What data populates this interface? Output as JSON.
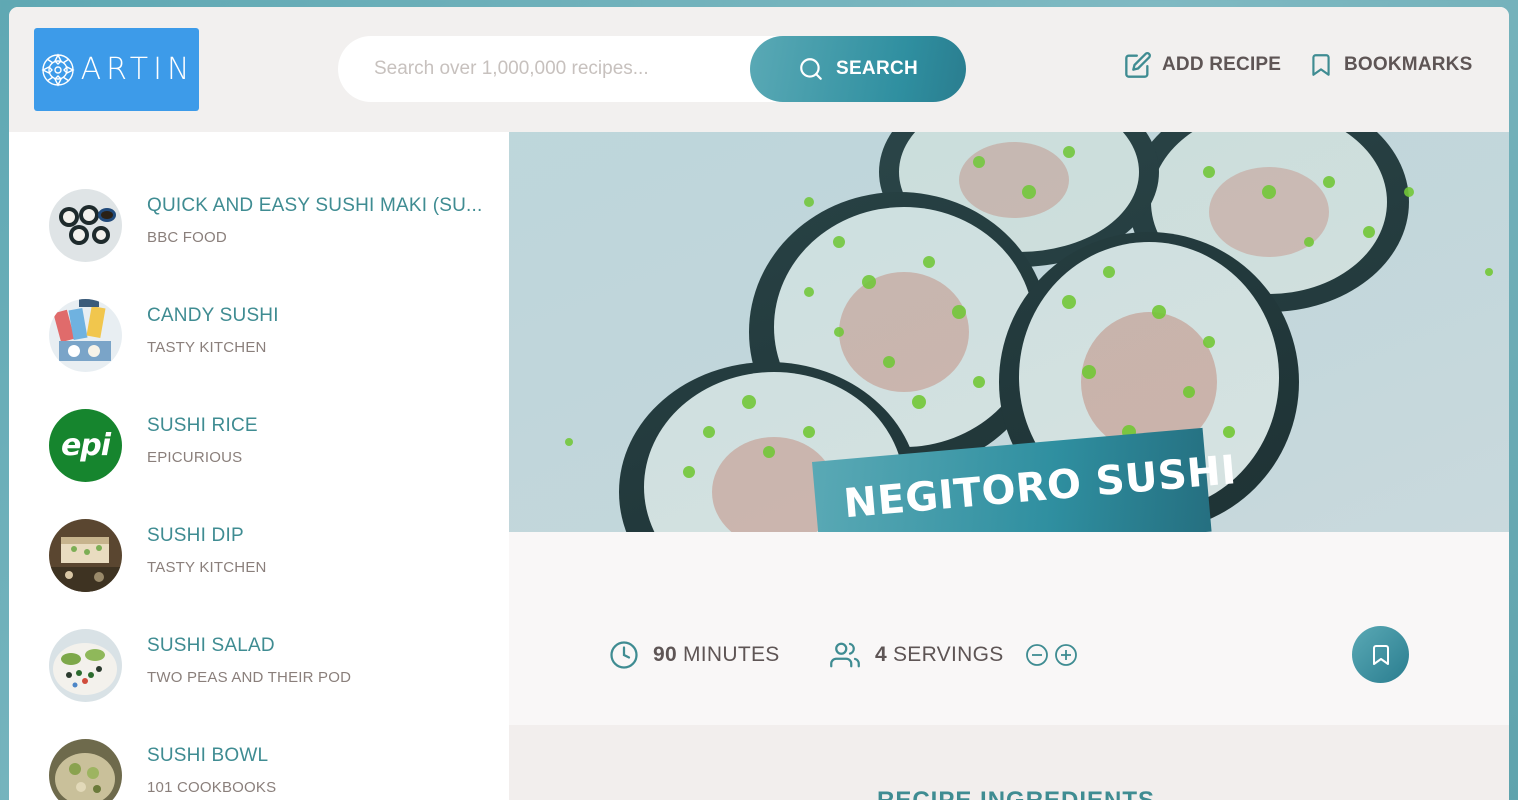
{
  "logo": {
    "text": "ARTIN",
    "icon": "mandala-logo-icon",
    "color": "#3d9be9"
  },
  "search": {
    "placeholder": "Search over 1,000,000 recipes...",
    "button_label": "SEARCH"
  },
  "nav": {
    "add_recipe": "ADD RECIPE",
    "bookmarks": "BOOKMARKS"
  },
  "results": [
    {
      "title": "QUICK AND EASY SUSHI MAKI (SU...",
      "publisher": "BBC FOOD"
    },
    {
      "title": "CANDY SUSHI",
      "publisher": "TASTY KITCHEN"
    },
    {
      "title": "SUSHI RICE",
      "publisher": "EPICURIOUS",
      "badge": "epi"
    },
    {
      "title": "SUSHI DIP",
      "publisher": "TASTY KITCHEN"
    },
    {
      "title": "SUSHI SALAD",
      "publisher": "TWO PEAS AND THEIR POD"
    },
    {
      "title": "SUSHI BOWL",
      "publisher": "101 COOKBOOKS"
    }
  ],
  "recipe": {
    "title": "NEGITORO SUSHI",
    "minutes": "90",
    "minutes_label": "MINUTES",
    "servings": "4",
    "servings_label": "SERVINGS",
    "ingredients_heading": "RECIPE INGREDIENTS"
  },
  "colors": {
    "accent": "#3f8c92",
    "gradient_start": "#5aa9b5",
    "gradient_end": "#2a7d8f"
  }
}
